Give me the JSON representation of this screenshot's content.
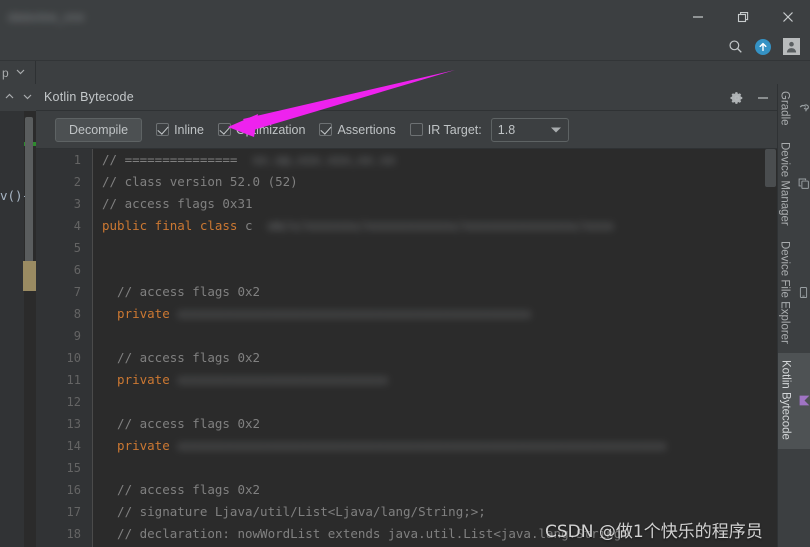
{
  "window": {
    "title": "dataview_one",
    "controls": {
      "minimize": "minimize-icon",
      "restore": "restore-icon",
      "close": "close-icon"
    }
  },
  "toolbar_top": {
    "search_icon": "search-icon",
    "update_icon": "update-arrow-icon",
    "avatar_icon": "avatar-icon"
  },
  "breadcrumb": {
    "trailing_label": "p",
    "chevron": "chevron-down-icon"
  },
  "editor_left": {
    "code_fragment": "v(){",
    "collapse_up": "chevron-up-icon",
    "collapse_down": "chevron-down-icon"
  },
  "tool_window": {
    "title": "Kotlin Bytecode",
    "settings_label": "gear-icon",
    "hide_label": "minimize-icon"
  },
  "options_bar": {
    "decompile_label": "Decompile",
    "checkboxes": [
      {
        "label": "Inline",
        "checked": true
      },
      {
        "label": "Optimization",
        "checked": true
      },
      {
        "label": "Assertions",
        "checked": true
      },
      {
        "label": "IR Target:",
        "checked": false
      }
    ],
    "ir_target_value": "1.8"
  },
  "code": {
    "lines": [
      {
        "no": "1",
        "segments": [
          {
            "t": "// ===============",
            "c": "cm"
          },
          {
            "t": "  xx.xp,xxx.xxx,xx.xx",
            "c": "blur"
          }
        ]
      },
      {
        "no": "2",
        "segments": [
          {
            "t": "// class version 52.0 (52)",
            "c": "cm"
          }
        ]
      },
      {
        "no": "3",
        "segments": [
          {
            "t": "// access flags 0x31",
            "c": "cm"
          }
        ]
      },
      {
        "no": "4",
        "segments": [
          {
            "t": "public final class ",
            "c": "kw"
          },
          {
            "t": "c",
            "c": "cm"
          },
          {
            "t": "  om/x/xxxxxxx/xxxxxxxxxxxx/xxxxxxxxxxxxxxx/xxxx",
            "c": "blur"
          }
        ]
      },
      {
        "no": "5",
        "segments": []
      },
      {
        "no": "6",
        "segments": []
      },
      {
        "no": "7",
        "segments": [
          {
            "t": "  // access flags 0x2",
            "c": "cm"
          }
        ]
      },
      {
        "no": "8",
        "segments": [
          {
            "t": "  private ",
            "c": "kw"
          },
          {
            "t": "xxxxxxxxxxxxxxxxxxxxxxxxxxxxxxxxxxxxxxxxxxxxxxx",
            "c": "blur"
          }
        ]
      },
      {
        "no": "9",
        "segments": []
      },
      {
        "no": "10",
        "segments": [
          {
            "t": "  // access flags 0x2",
            "c": "cm"
          }
        ]
      },
      {
        "no": "11",
        "segments": [
          {
            "t": "  private ",
            "c": "kw"
          },
          {
            "t": "xxxxxxxxxxxxxxxxxxxxxxxxxxxx",
            "c": "blur"
          }
        ]
      },
      {
        "no": "12",
        "segments": []
      },
      {
        "no": "13",
        "segments": [
          {
            "t": "  // access flags 0x2",
            "c": "cm"
          }
        ]
      },
      {
        "no": "14",
        "segments": [
          {
            "t": "  private ",
            "c": "kw"
          },
          {
            "t": "xxxxxxxxxxxxxxxxxxxxxxxxxxxxxxxxxxxxxxxxxxxxxxxxxxxxxxxxxxxxxxxxx",
            "c": "blur"
          }
        ]
      },
      {
        "no": "15",
        "segments": []
      },
      {
        "no": "16",
        "segments": [
          {
            "t": "  // access flags 0x2",
            "c": "cm"
          }
        ]
      },
      {
        "no": "17",
        "segments": [
          {
            "t": "  // signature Ljava/util/List<Ljava/lang/String;>;",
            "c": "cm"
          }
        ]
      },
      {
        "no": "18",
        "segments": [
          {
            "t": "  // declaration: nowWordList extends java.util.List<java.lang.String>",
            "c": "cm"
          }
        ]
      }
    ]
  },
  "right_tabs": [
    {
      "label": "Gradle",
      "icon": "gradle-elephant-icon",
      "active": false
    },
    {
      "label": "Device Manager",
      "icon": "device-manager-icon",
      "active": false
    },
    {
      "label": "Device File Explorer",
      "icon": "device-file-explorer-icon",
      "active": false
    },
    {
      "label": "Kotlin Bytecode",
      "icon": "kotlin-icon",
      "active": true
    }
  ],
  "annotation": {
    "arrow_color": "#ee22ee",
    "points_to": "Decompile"
  },
  "watermark": {
    "text": "CSDN @做1个快乐的程序员"
  },
  "colors": {
    "window_chrome": "#3c3f41",
    "editor_bg": "#2b2b2b",
    "gutter_bg": "#313335",
    "keyword": "#cc7832",
    "comment": "#808080",
    "accent_blue": "#3592c4",
    "arrow_magenta": "#ee22ee"
  }
}
